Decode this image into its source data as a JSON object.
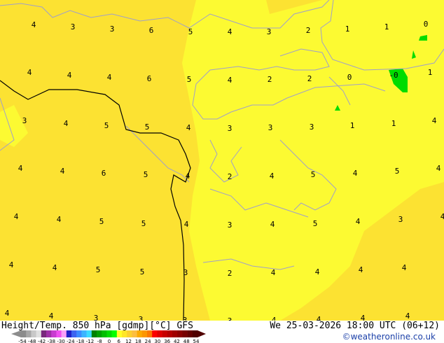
{
  "map": {
    "labels": [
      "4",
      "3",
      "3",
      "6",
      "5",
      "4",
      "3",
      "2",
      "1",
      "1",
      "0",
      "4",
      "4",
      "4",
      "6",
      "5",
      "4",
      "2",
      "2",
      "0",
      "-0",
      "1",
      "3",
      "4",
      "5",
      "5",
      "4",
      "3",
      "3",
      "3",
      "1",
      "1",
      "4",
      "4",
      "4",
      "6",
      "5",
      "4",
      "2",
      "4",
      "5",
      "4",
      "5",
      "4",
      "4",
      "4",
      "5",
      "5",
      "4",
      "3",
      "4",
      "5",
      "4",
      "3",
      "4",
      "4",
      "4",
      "5",
      "5",
      "3",
      "2",
      "4",
      "4",
      "4",
      "4",
      "4",
      "4",
      "3",
      "3",
      "3",
      "3",
      "4",
      "4",
      "4",
      "4"
    ],
    "colors": {
      "bright": "#fcfa32",
      "warm": "#fce232",
      "green": "#00dc00",
      "coast": "#a0a0c8",
      "border": "#000000"
    }
  },
  "footer": {
    "title": "Height/Temp. 850 hPa [gdmp][°C] GFS",
    "datetime": "We 25-03-2026 18:00 UTC (06+12)",
    "credit": "©weatheronline.co.uk",
    "legend_ticks": [
      "-54",
      "-48",
      "-42",
      "-38",
      "-30",
      "-24",
      "-18",
      "-12",
      "-8",
      "0",
      "6",
      "12",
      "18",
      "24",
      "30",
      "36",
      "42",
      "48",
      "54"
    ],
    "legend_colors": [
      "#8c8c8c",
      "#a8a8a8",
      "#c8c8c8",
      "#e0e0e0",
      "#78287c",
      "#a030a8",
      "#c83cd0",
      "#f050f0",
      "#f8a0f8",
      "#2020c8",
      "#3c64f0",
      "#3c8cff",
      "#3cb4ff",
      "#3cdcff",
      "#008200",
      "#00a000",
      "#00be00",
      "#00dc00",
      "#00ff00",
      "#ffff28",
      "#ffe628",
      "#fcd030",
      "#fcbe40",
      "#fcaa00",
      "#fc9600",
      "#fc7800",
      "#fc0000",
      "#e00000",
      "#c80000",
      "#b40000",
      "#a00000",
      "#8c0000",
      "#780000",
      "#640000",
      "#500000"
    ]
  }
}
